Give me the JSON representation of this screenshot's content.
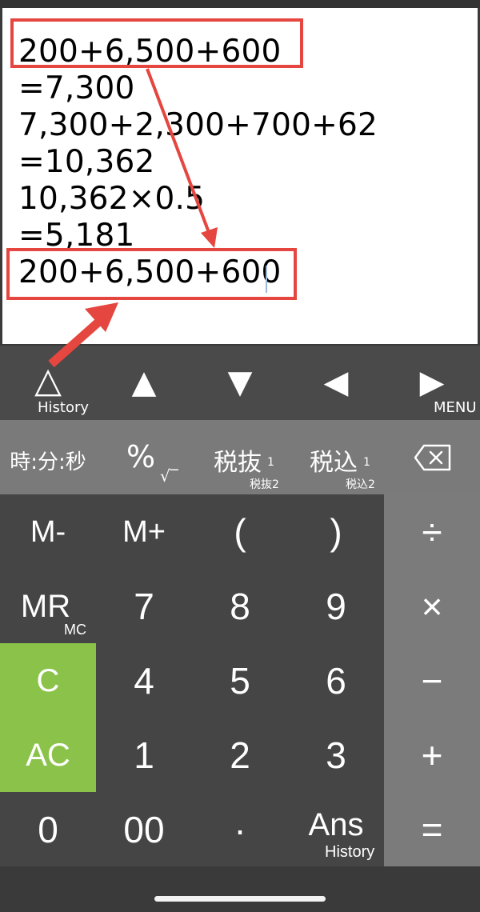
{
  "display": {
    "lines": [
      "200+6,500+600",
      "=7,300",
      "7,300+2,300+700+62",
      "=10,362",
      "10,362×0.5",
      "=5,181",
      "200+6,500+600"
    ]
  },
  "nav": {
    "history_glyph": "△",
    "history_label": "History",
    "up": "▲",
    "down": "▼",
    "left": "◀",
    "right": "▶",
    "menu_label": "MENU"
  },
  "func": {
    "time": "時:分:秒",
    "percent": "%",
    "sqrt": "√‾",
    "tax_ex": "税抜",
    "tax_ex_sub": "1",
    "tax_ex_small": "税抜2",
    "tax_in": "税込",
    "tax_in_sub": "1",
    "tax_in_small": "税込2",
    "backspace": "⌫"
  },
  "keys": {
    "m_minus": "M-",
    "m_plus": "M+",
    "paren_open": "(",
    "paren_close": ")",
    "divide": "÷",
    "mr": "MR",
    "mc": "MC",
    "seven": "7",
    "eight": "8",
    "nine": "9",
    "multiply": "×",
    "c": "C",
    "four": "4",
    "five": "5",
    "six": "6",
    "minus": "−",
    "ac": "AC",
    "one": "1",
    "two": "2",
    "three": "3",
    "plus": "+",
    "zero": "0",
    "double_zero": "00",
    "dot": "·",
    "ans": "Ans",
    "ans_history": "History",
    "equals": "="
  },
  "colors": {
    "highlight": "#e5463f",
    "green_key": "#8bc34a",
    "display_bg": "#ffffff"
  }
}
